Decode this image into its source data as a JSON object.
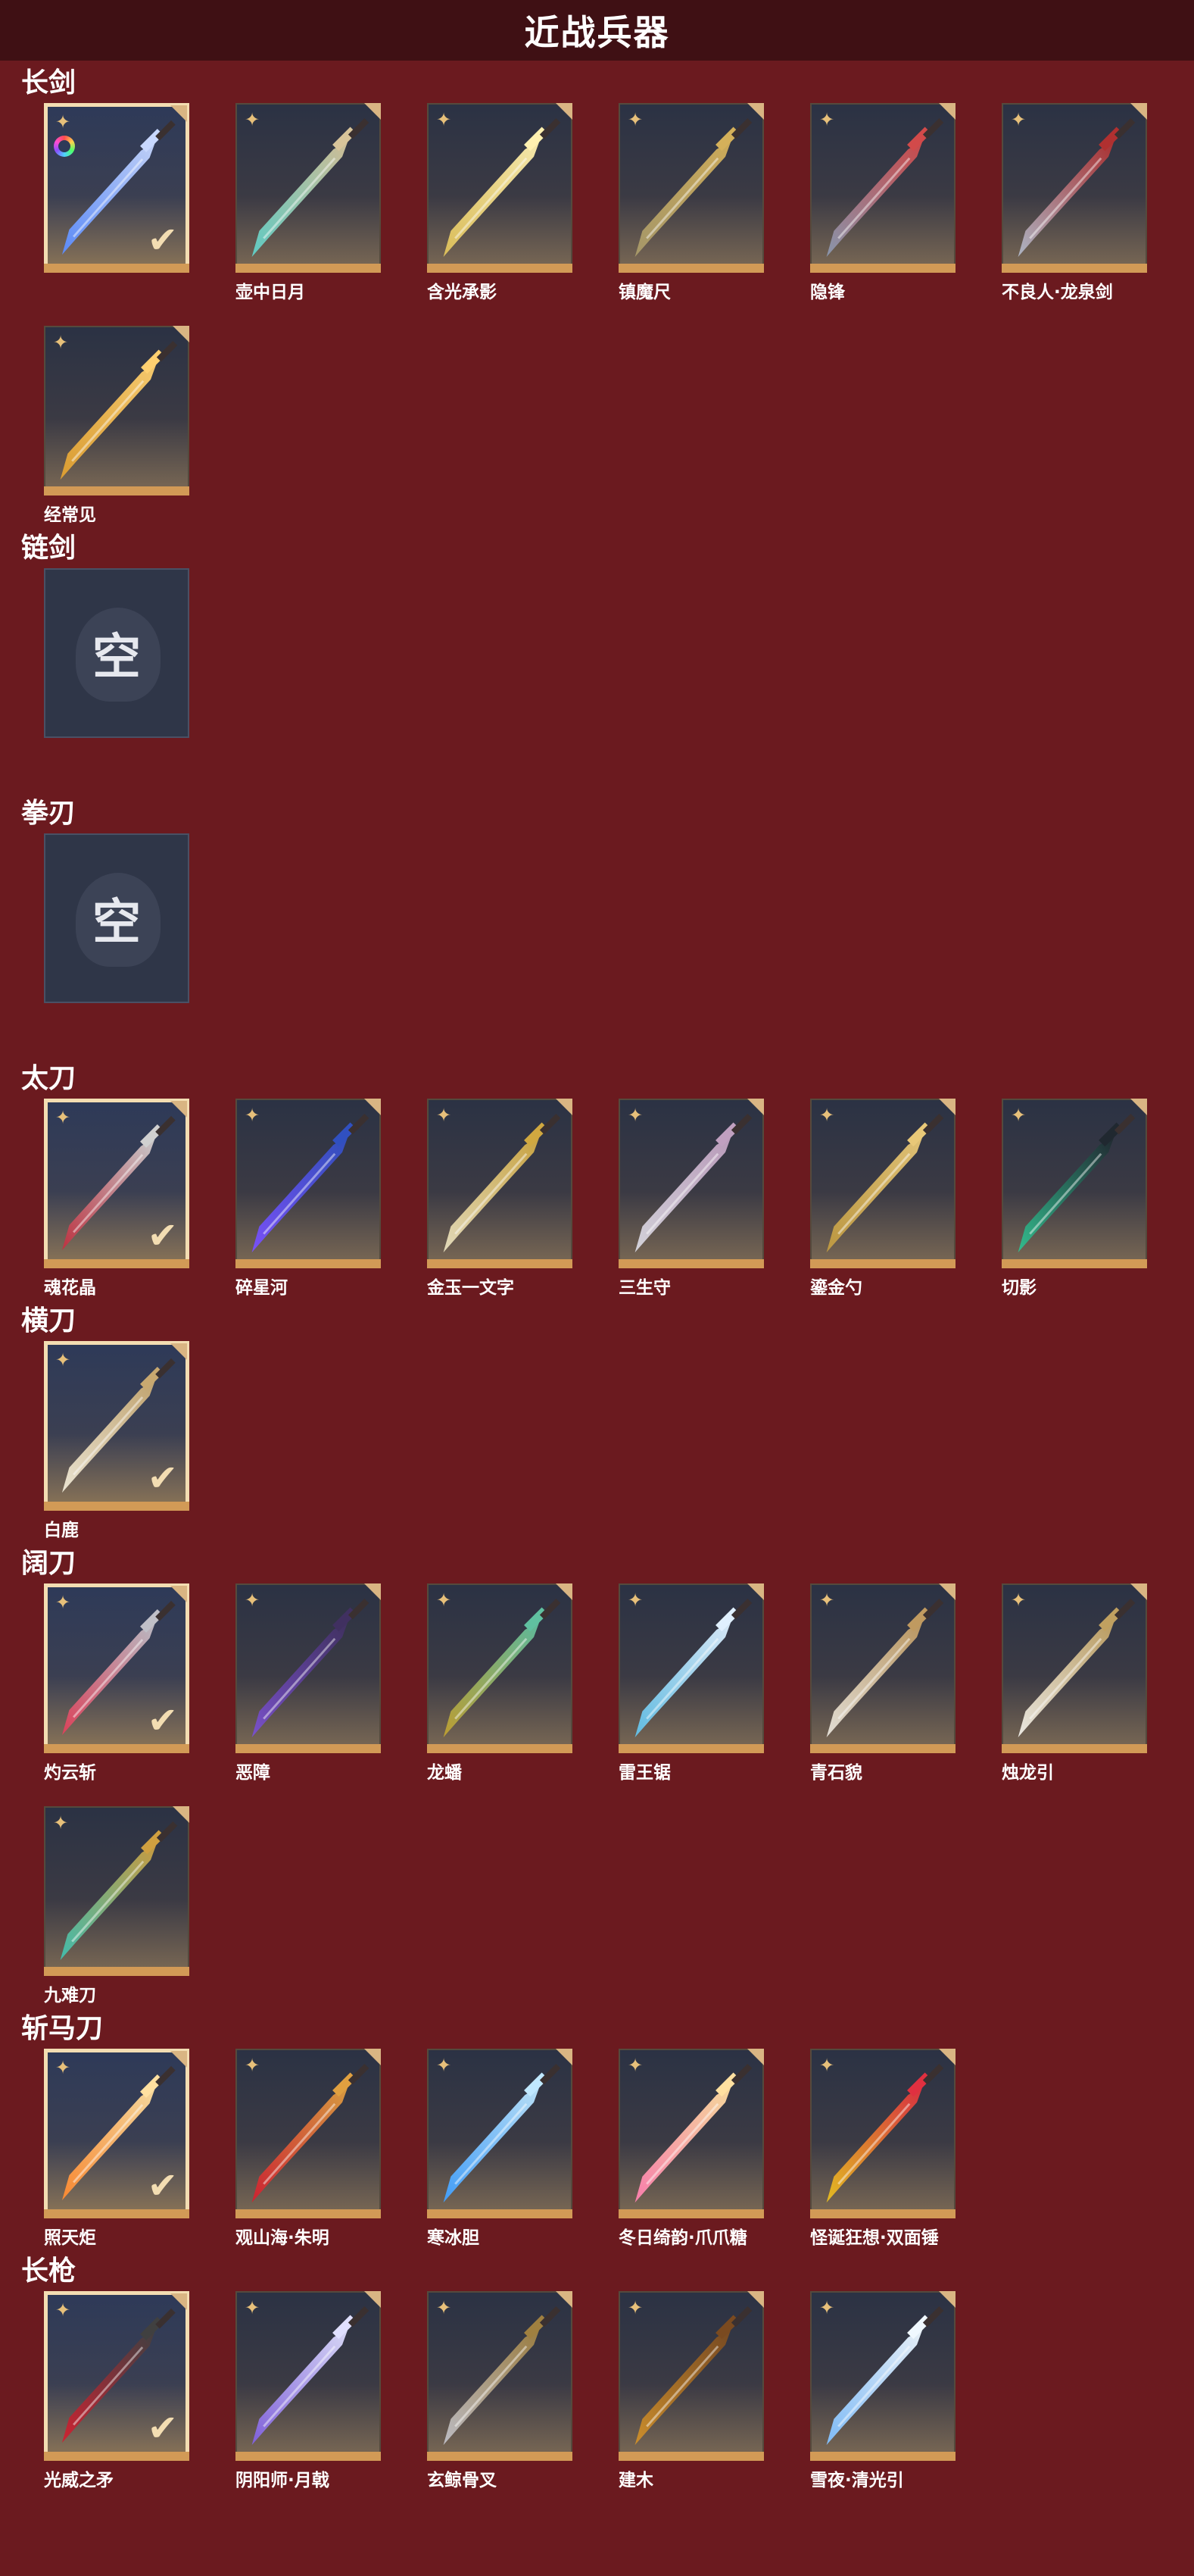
{
  "page_title": "近战兵器",
  "empty_label": "空",
  "colors": {
    "background": "#6b1a1f",
    "title_bar": "#3f1014",
    "card_gold": "#d29a56",
    "selected_border": "#f3ddb2"
  },
  "icons": {
    "corner": "ornament-star-icon",
    "selected": "checkmark-icon",
    "dye": "rainbow-ring-icon"
  },
  "sections": [
    {
      "title": "长剑",
      "items": [
        {
          "name": "",
          "selected": true,
          "dye": true,
          "palette": [
            "#5a8cff",
            "#c8d8ff"
          ]
        },
        {
          "name": "壶中日月",
          "selected": false,
          "palette": [
            "#5fd0c8",
            "#d8c49a"
          ]
        },
        {
          "name": "含光承影",
          "selected": false,
          "palette": [
            "#e0c25a",
            "#fff0b0"
          ]
        },
        {
          "name": "镇魔尺",
          "selected": false,
          "palette": [
            "#a89a6a",
            "#d4b05a"
          ]
        },
        {
          "name": "隐锋",
          "selected": false,
          "palette": [
            "#8a98b0",
            "#d24a4a"
          ]
        },
        {
          "name": "不良人·龙泉剑",
          "selected": false,
          "palette": [
            "#b0b8c8",
            "#b03030"
          ]
        },
        {
          "name": "经常见",
          "selected": false,
          "palette": [
            "#e0a030",
            "#ffd070"
          ]
        }
      ]
    },
    {
      "title": "链剑",
      "empty": true,
      "items": []
    },
    {
      "title": "拳刃",
      "empty": true,
      "items": []
    },
    {
      "title": "太刀",
      "items": [
        {
          "name": "魂花晶",
          "selected": true,
          "palette": [
            "#c03040",
            "#d0d0d0"
          ]
        },
        {
          "name": "碎星河",
          "selected": false,
          "palette": [
            "#7a50ff",
            "#3050c0"
          ]
        },
        {
          "name": "金玉一文字",
          "selected": false,
          "palette": [
            "#e8e0c0",
            "#d0a840"
          ]
        },
        {
          "name": "三生守",
          "selected": false,
          "palette": [
            "#d8d8e0",
            "#c0a0c0"
          ]
        },
        {
          "name": "鎏金勺",
          "selected": false,
          "palette": [
            "#c09a40",
            "#e8c878"
          ]
        },
        {
          "name": "切影",
          "selected": false,
          "palette": [
            "#30c090",
            "#202830"
          ]
        }
      ]
    },
    {
      "title": "横刀",
      "items": [
        {
          "name": "白鹿",
          "selected": true,
          "palette": [
            "#f0ead8",
            "#c8a870"
          ]
        }
      ]
    },
    {
      "title": "阔刀",
      "items": [
        {
          "name": "灼云斩",
          "selected": true,
          "palette": [
            "#e0405a",
            "#c0c0c8"
          ]
        },
        {
          "name": "恶障",
          "selected": false,
          "palette": [
            "#7a50d0",
            "#403060"
          ]
        },
        {
          "name": "龙蟠",
          "selected": false,
          "palette": [
            "#c0a030",
            "#60c0a0"
          ]
        },
        {
          "name": "雷王锯",
          "selected": false,
          "palette": [
            "#60c0e8",
            "#e0f0ff"
          ]
        },
        {
          "name": "青石貌",
          "selected": false,
          "palette": [
            "#e8e4dc",
            "#c09a60"
          ]
        },
        {
          "name": "烛龙引",
          "selected": false,
          "palette": [
            "#f0eee8",
            "#c0a060"
          ]
        },
        {
          "name": "九难刀",
          "selected": false,
          "palette": [
            "#40c0b0",
            "#d0a040"
          ]
        }
      ]
    },
    {
      "title": "斩马刀",
      "items": [
        {
          "name": "照天炬",
          "selected": true,
          "palette": [
            "#ff8a30",
            "#ffe0a0"
          ]
        },
        {
          "name": "观山海·朱明",
          "selected": false,
          "palette": [
            "#d02030",
            "#e0a040"
          ]
        },
        {
          "name": "寒冰胆",
          "selected": false,
          "palette": [
            "#40a0ff",
            "#c0e8ff"
          ]
        },
        {
          "name": "冬日绮韵·爪爪糖",
          "selected": false,
          "palette": [
            "#ff80b0",
            "#ffe0a0"
          ]
        },
        {
          "name": "怪诞狂想·双面锤",
          "selected": false,
          "palette": [
            "#e8c020",
            "#e03040"
          ]
        }
      ]
    },
    {
      "title": "长枪",
      "items": [
        {
          "name": "光威之矛",
          "selected": true,
          "palette": [
            "#d02030",
            "#404040"
          ]
        },
        {
          "name": "阴阳师·月戟",
          "selected": false,
          "palette": [
            "#8060e0",
            "#e0e0ff"
          ]
        },
        {
          "name": "玄鲸骨叉",
          "selected": false,
          "palette": [
            "#c0c0c8",
            "#a08040"
          ]
        },
        {
          "name": "建木",
          "selected": false,
          "palette": [
            "#d0902a",
            "#7a4a20"
          ]
        },
        {
          "name": "雪夜·清光引",
          "selected": false,
          "palette": [
            "#80c0ff",
            "#f0f8ff"
          ]
        }
      ]
    }
  ]
}
